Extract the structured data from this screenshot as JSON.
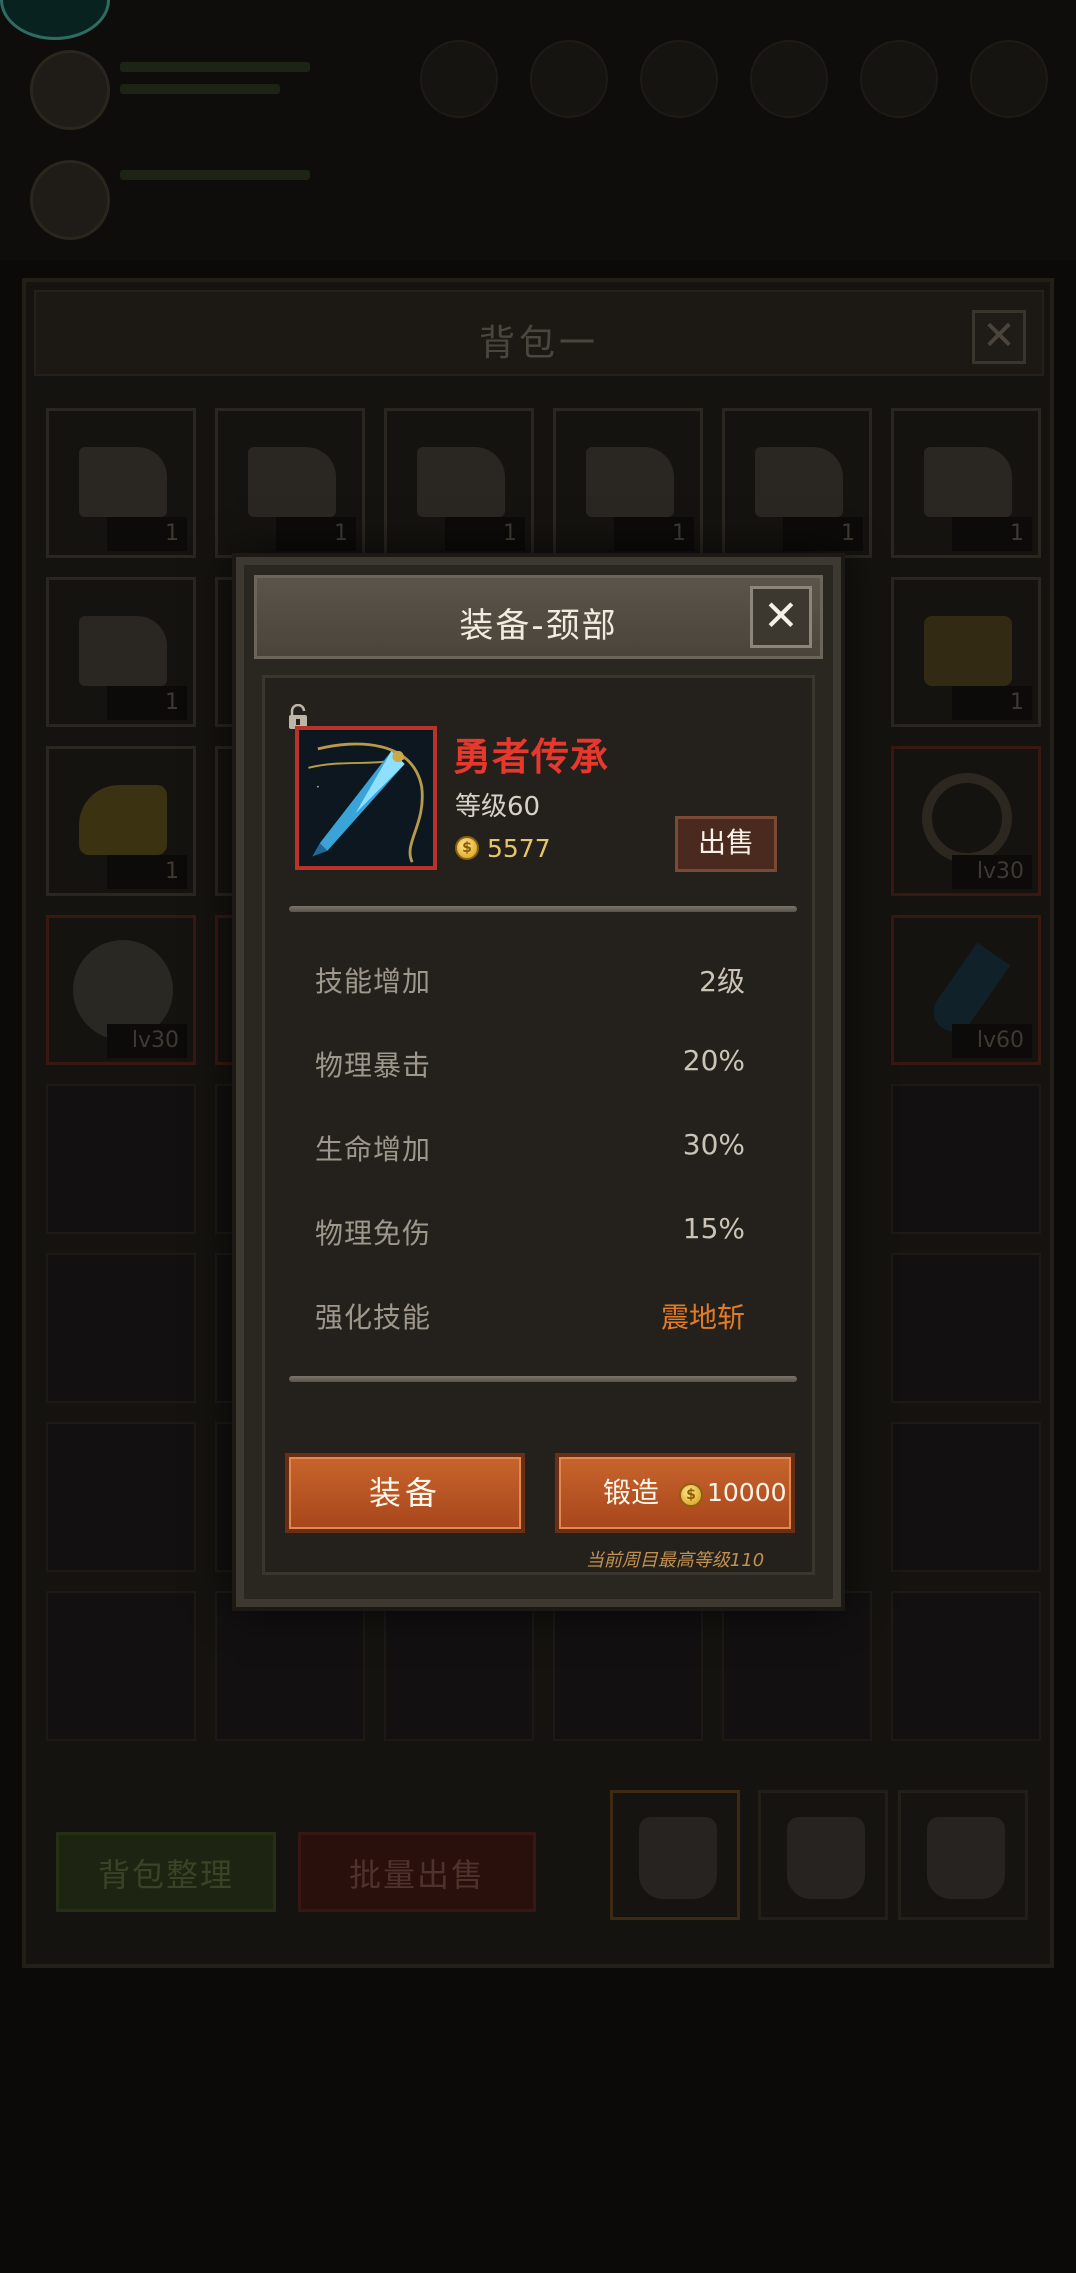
{
  "background": {
    "bag": {
      "title": "背包一",
      "close_glyph": "✕",
      "slots": [
        {
          "item": "cake",
          "count": "1",
          "frame": "normal"
        },
        {
          "item": "cake",
          "count": "1",
          "frame": "normal"
        },
        {
          "item": "cake",
          "count": "1",
          "frame": "normal"
        },
        {
          "item": "cake",
          "count": "1",
          "frame": "normal"
        },
        {
          "item": "cake",
          "count": "1",
          "frame": "normal"
        },
        {
          "item": "cake",
          "count": "1",
          "frame": "normal"
        },
        {
          "item": "cake",
          "count": "1",
          "frame": "normal"
        },
        {
          "item": "beer",
          "count": "1",
          "frame": "normal"
        },
        {
          "item": "cheese",
          "count": "1",
          "frame": "normal"
        },
        {
          "item": "ring",
          "count": "lv30",
          "frame": "red"
        },
        {
          "item": "orb",
          "count": "lv30",
          "frame": "red"
        },
        {
          "item": "pendant",
          "count": "lv60",
          "frame": "red"
        }
      ],
      "sort_label": "背包整理",
      "bulk_sell_label": "批量出售"
    }
  },
  "modal": {
    "title": "装备-颈部",
    "close_glyph": "✕",
    "item": {
      "name": "勇者传承",
      "level": "等级60",
      "price": "5577",
      "locked": false
    },
    "sell_label": "出售",
    "stats": [
      {
        "label": "技能增加",
        "value": "2级"
      },
      {
        "label": "物理暴击",
        "value": "20%"
      },
      {
        "label": "生命增加",
        "value": "30%"
      },
      {
        "label": "物理免伤",
        "value": "15%"
      },
      {
        "label": "强化技能",
        "value": "震地斩"
      }
    ],
    "equip_label": "装备",
    "forge_label": "锻造",
    "forge_cost": "10000",
    "forge_note": "当前周目最高等级110",
    "coin_glyph": "$"
  },
  "colors": {
    "item_name": "#e8372c",
    "skill_value": "#e27b27",
    "price": "#e4c66a",
    "button_orange": "#b8502a"
  }
}
